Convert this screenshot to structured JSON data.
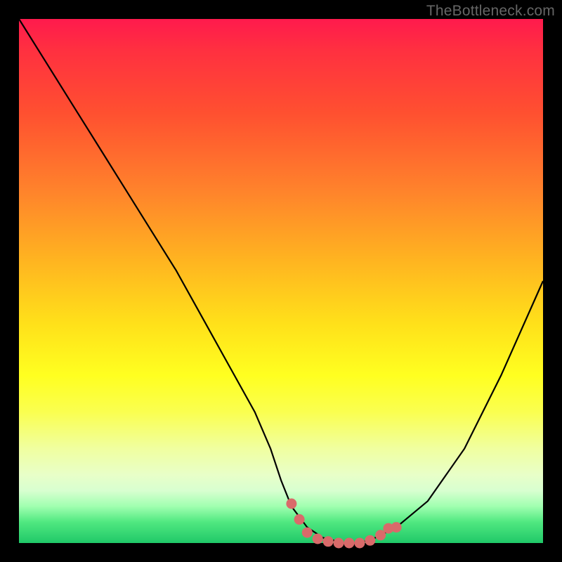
{
  "watermark": "TheBottleneck.com",
  "chart_data": {
    "type": "line",
    "title": "",
    "xlabel": "",
    "ylabel": "",
    "xlim": [
      0,
      100
    ],
    "ylim": [
      0,
      100
    ],
    "series": [
      {
        "name": "bottleneck-curve",
        "x": [
          0,
          5,
          10,
          15,
          20,
          25,
          30,
          35,
          40,
          45,
          48,
          50,
          52,
          55,
          58,
          62,
          65,
          68,
          72,
          78,
          85,
          92,
          100
        ],
        "y": [
          100,
          92,
          84,
          76,
          68,
          60,
          52,
          43,
          34,
          25,
          18,
          12,
          7,
          3,
          1,
          0,
          0,
          1,
          3,
          8,
          18,
          32,
          50
        ],
        "color": "#000000"
      }
    ],
    "markers": {
      "name": "highlight-dots",
      "color": "#d96a6a",
      "points": [
        {
          "x": 52,
          "y": 7.5
        },
        {
          "x": 53.5,
          "y": 4.5
        },
        {
          "x": 55,
          "y": 2
        },
        {
          "x": 57,
          "y": 0.8
        },
        {
          "x": 59,
          "y": 0.3
        },
        {
          "x": 61,
          "y": 0
        },
        {
          "x": 63,
          "y": 0
        },
        {
          "x": 65,
          "y": 0
        },
        {
          "x": 67,
          "y": 0.5
        },
        {
          "x": 69,
          "y": 1.5
        },
        {
          "x": 70.5,
          "y": 2.8
        },
        {
          "x": 72,
          "y": 3
        }
      ]
    }
  }
}
